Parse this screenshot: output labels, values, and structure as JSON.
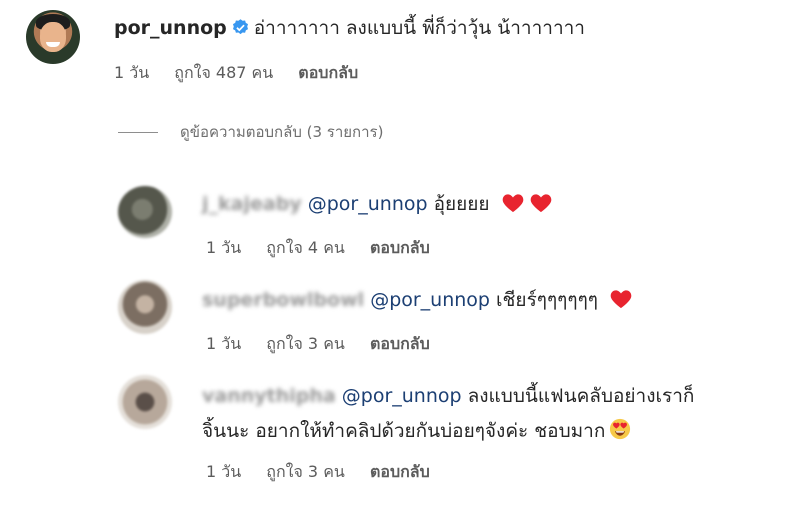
{
  "main_comment": {
    "username": "por_unnop",
    "text": "อ่าาาาาาา ลงแบบนี้ พี่ก็ว่าวุ้น น้าาาาาาา",
    "time": "1 วัน",
    "likes": "ถูกใจ 487 คน",
    "reply_label": "ตอบกลับ",
    "verified_color": "#3897f0"
  },
  "view_replies_label": "ดูข้อความตอบกลับ (3 รายการ)",
  "replies": [
    {
      "username": "j_kajeaby",
      "mention": "@por_unnop",
      "text": "อุ้ยยยย",
      "emojis": [
        "red-heart",
        "red-heart"
      ],
      "time": "1 วัน",
      "likes": "ถูกใจ 4 คน",
      "reply_label": "ตอบกลับ"
    },
    {
      "username": "superbowlbowl",
      "mention": "@por_unnop",
      "text": "เชียร์ๆๆๆๆๆๆ",
      "emojis": [
        "red-heart"
      ],
      "time": "1 วัน",
      "likes": "ถูกใจ 3 คน",
      "reply_label": "ตอบกลับ"
    },
    {
      "username": "vannythipha",
      "mention": "@por_unnop",
      "text_line1": "ลงแบบนี้แฟนคลับอย่างเราก็",
      "text_line2": "จิ้นนะ อยากให้ทำคลิปด้วยกันบ่อยๆจังค่ะ ชอบมาก",
      "emojis": [
        "heart-eyes-face"
      ],
      "time": "1 วัน",
      "likes": "ถูกใจ 3 คน",
      "reply_label": "ตอบกลับ"
    }
  ],
  "colors": {
    "heart": "#e8242f",
    "mention": "#1c3f73",
    "meta_text": "#5c5c5c"
  }
}
